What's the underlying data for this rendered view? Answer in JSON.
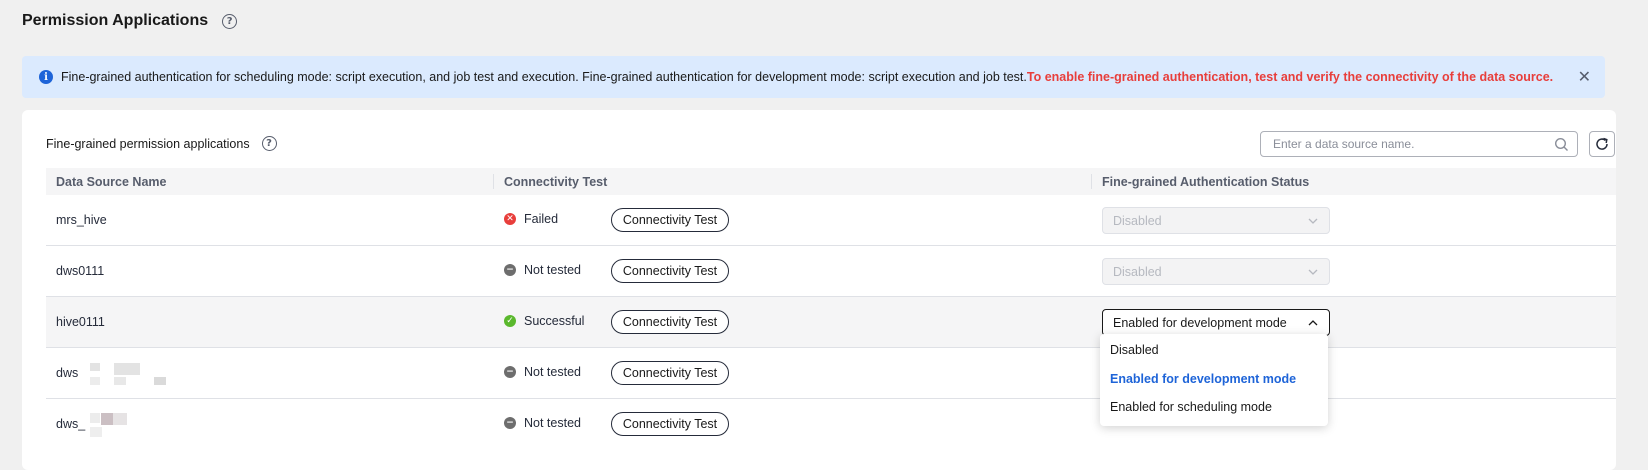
{
  "page": {
    "title": "Permission Applications"
  },
  "banner": {
    "info_text": "Fine-grained authentication for scheduling mode: script execution, and job test and execution. Fine-grained authentication for development mode: script execution and job test.",
    "warning_text": "To enable fine-grained authentication, test and verify the connectivity of the data source.",
    "close_label": "✕"
  },
  "section": {
    "title": "Fine-grained permission applications"
  },
  "search": {
    "placeholder": "Enter a data source name."
  },
  "table": {
    "columns": [
      "Data Source Name",
      "Connectivity Test",
      "Fine-grained Authentication Status"
    ],
    "rows": [
      {
        "name": "mrs_hive",
        "status": "Failed",
        "status_icon": "failed-icon",
        "button": "Connectivity Test",
        "auth": "Disabled"
      },
      {
        "name": "dws0111",
        "status": "Not tested",
        "status_icon": "not-tested-icon",
        "button": "Connectivity Test",
        "auth": "Disabled"
      },
      {
        "name": "hive0111",
        "status": "Successful",
        "status_icon": "success-icon",
        "button": "Connectivity Test",
        "auth": "Enabled for development mode"
      },
      {
        "name": "dws",
        "status": "Not tested",
        "status_icon": "not-tested-icon",
        "button": "Connectivity Test",
        "auth": ""
      },
      {
        "name": "dws_",
        "status": "Not tested",
        "status_icon": "not-tested-icon",
        "button": "Connectivity Test",
        "auth": ""
      }
    ]
  },
  "dropdown": {
    "options": [
      "Disabled",
      "Enabled for development mode",
      "Enabled for scheduling mode"
    ],
    "selected": "Enabled for development mode"
  },
  "colors": {
    "accent": "#1e64d8",
    "error": "#e83e3b",
    "success": "#5ab82d",
    "banner_bg": "#dbeafe"
  }
}
